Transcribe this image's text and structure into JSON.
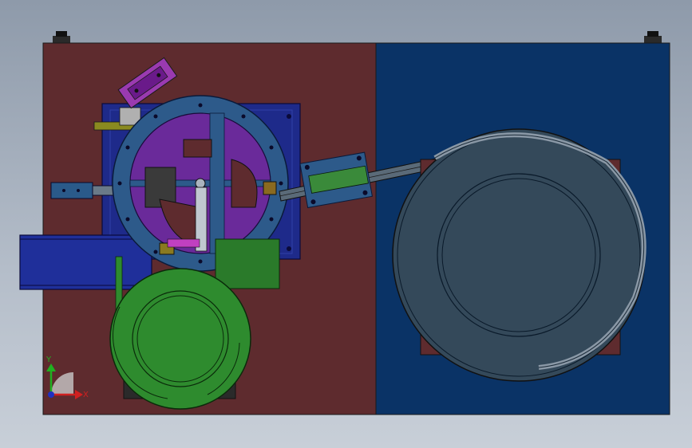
{
  "viewport": {
    "background_top": "#8e9aaa",
    "background_bottom": "#c8cfd8"
  },
  "model": {
    "left_plate_color": "#5e2b2e",
    "right_plate_color": "#0a3366",
    "rotary_table_color": "#2d5a8a",
    "inner_disc_color": "#6a2a9a",
    "green_bowl_color": "#2e8b2e",
    "large_bowl_color": "#34495a",
    "base_block_color": "#1e2a8a",
    "rail_color": "#5a6a78"
  },
  "triad": {
    "x_label": "X",
    "y_label": "Y",
    "x_color": "#d02020",
    "y_color": "#20b020",
    "z_color": "#2030c0"
  }
}
